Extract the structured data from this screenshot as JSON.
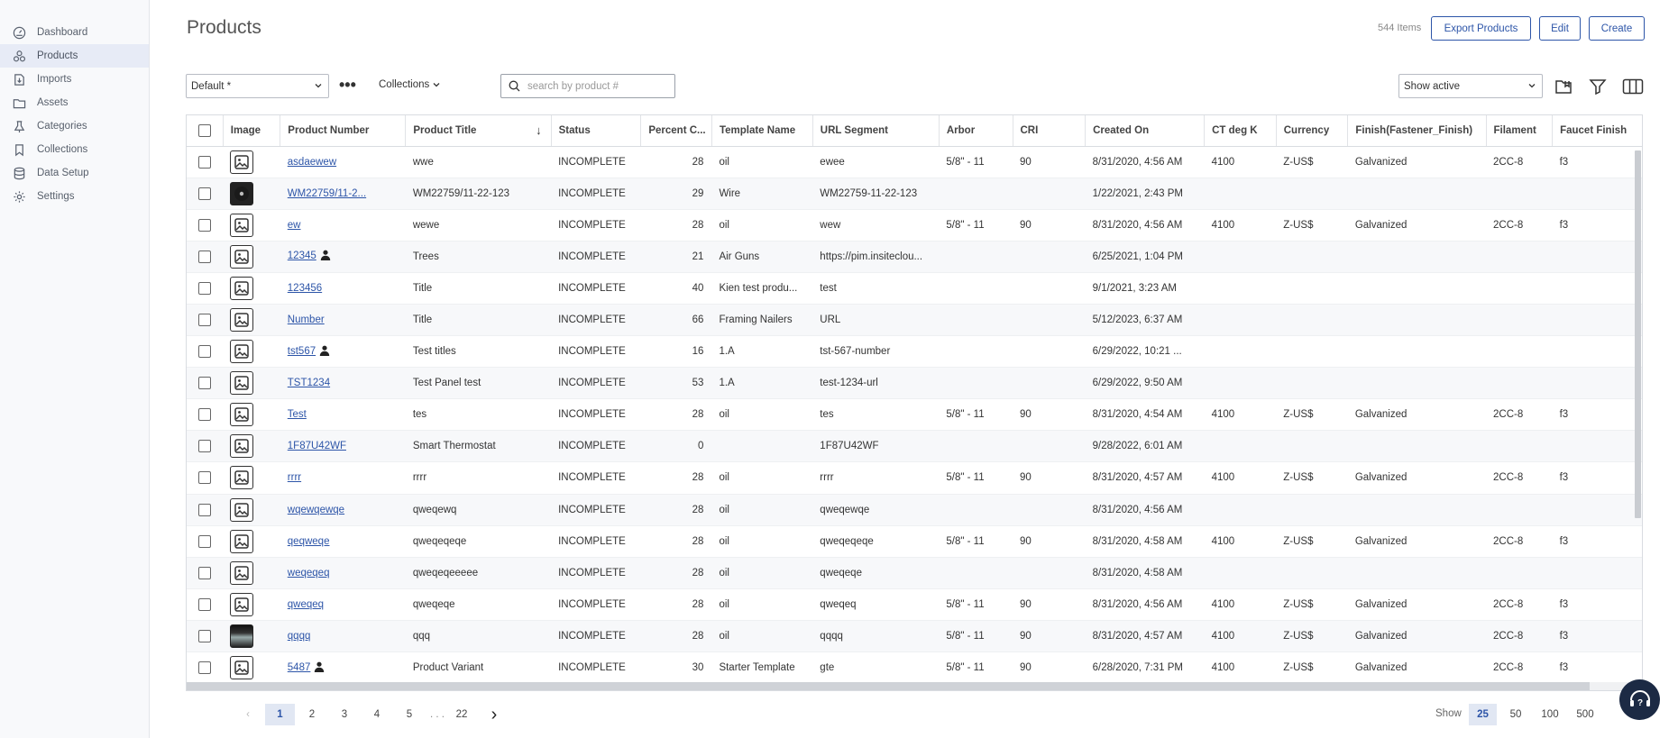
{
  "sidebar": {
    "items": [
      {
        "label": "Dashboard",
        "icon": "dashboard-icon"
      },
      {
        "label": "Products",
        "icon": "products-icon",
        "active": true
      },
      {
        "label": "Imports",
        "icon": "imports-icon"
      },
      {
        "label": "Assets",
        "icon": "folder-icon"
      },
      {
        "label": "Categories",
        "icon": "categories-icon"
      },
      {
        "label": "Collections",
        "icon": "collections-icon"
      },
      {
        "label": "Data Setup",
        "icon": "database-icon"
      },
      {
        "label": "Settings",
        "icon": "gear-icon"
      }
    ]
  },
  "header": {
    "title": "Products",
    "items_count": "544 Items",
    "export_label": "Export Products",
    "edit_label": "Edit",
    "create_label": "Create"
  },
  "toolbar": {
    "view_select_value": "Default *",
    "more_label": "•••",
    "collections_label": "Collections",
    "search_placeholder": "search by product #",
    "active_select_value": "Show active"
  },
  "table": {
    "columns": [
      "Image",
      "Product Number",
      "Product Title",
      "Status",
      "Percent C...",
      "Template Name",
      "URL Segment",
      "Arbor",
      "CRI",
      "Created On",
      "CT deg K",
      "Currency",
      "Finish(Fastener_Finish)",
      "Filament",
      "Faucet Finish"
    ],
    "rows": [
      {
        "img": "image",
        "number": "asdaewew",
        "user": false,
        "title": "wwe",
        "status": "INCOMPLETE",
        "percent": "28",
        "template": "oil",
        "url": "ewee",
        "arbor": "5/8\" - 11",
        "cri": "90",
        "created": "8/31/2020, 4:56 AM",
        "ct": "4100",
        "currency": "Z-US$",
        "finish": "Galvanized",
        "filament": "2CC-8",
        "faucet": "f3"
      },
      {
        "img": "dark",
        "number": "WM22759/11-2...",
        "user": false,
        "title": "WM22759/11-22-123",
        "status": "INCOMPLETE",
        "percent": "29",
        "template": "Wire",
        "url": "WM22759-11-22-123",
        "arbor": "",
        "cri": "",
        "created": "1/22/2021, 2:43 PM",
        "ct": "",
        "currency": "",
        "finish": "",
        "filament": "",
        "faucet": ""
      },
      {
        "img": "image",
        "number": "ew",
        "user": false,
        "title": "wewe",
        "status": "INCOMPLETE",
        "percent": "28",
        "template": "oil",
        "url": "wew",
        "arbor": "5/8\" - 11",
        "cri": "90",
        "created": "8/31/2020, 4:56 AM",
        "ct": "4100",
        "currency": "Z-US$",
        "finish": "Galvanized",
        "filament": "2CC-8",
        "faucet": "f3"
      },
      {
        "img": "image",
        "number": "12345",
        "user": true,
        "title": "Trees",
        "status": "INCOMPLETE",
        "percent": "21",
        "template": "Air Guns",
        "url": "https://pim.insiteclou...",
        "arbor": "",
        "cri": "",
        "created": "6/25/2021, 1:04 PM",
        "ct": "",
        "currency": "",
        "finish": "",
        "filament": "",
        "faucet": ""
      },
      {
        "img": "image",
        "number": "123456",
        "user": false,
        "title": "Title",
        "status": "INCOMPLETE",
        "percent": "40",
        "template": "Kien test produ...",
        "url": "test",
        "arbor": "",
        "cri": "",
        "created": "9/1/2021, 3:23 AM",
        "ct": "",
        "currency": "",
        "finish": "",
        "filament": "",
        "faucet": ""
      },
      {
        "img": "image",
        "number": "Number",
        "user": false,
        "title": "Title",
        "status": "INCOMPLETE",
        "percent": "66",
        "template": "Framing Nailers",
        "url": "URL",
        "arbor": "",
        "cri": "",
        "created": "5/12/2023, 6:37 AM",
        "ct": "",
        "currency": "",
        "finish": "",
        "filament": "",
        "faucet": ""
      },
      {
        "img": "image",
        "number": "tst567",
        "user": true,
        "title": "Test titles",
        "status": "INCOMPLETE",
        "percent": "16",
        "template": "1.A",
        "url": "tst-567-number",
        "arbor": "",
        "cri": "",
        "created": "6/29/2022, 10:21 ...",
        "ct": "",
        "currency": "",
        "finish": "",
        "filament": "",
        "faucet": ""
      },
      {
        "img": "image",
        "number": "TST1234",
        "user": false,
        "title": "Test Panel test",
        "status": "INCOMPLETE",
        "percent": "53",
        "template": "1.A",
        "url": "test-1234-url",
        "arbor": "",
        "cri": "",
        "created": "6/29/2022, 9:50 AM",
        "ct": "",
        "currency": "",
        "finish": "",
        "filament": "",
        "faucet": ""
      },
      {
        "img": "image",
        "number": "Test",
        "user": false,
        "title": "tes",
        "status": "INCOMPLETE",
        "percent": "28",
        "template": "oil",
        "url": "tes",
        "arbor": "5/8\" - 11",
        "cri": "90",
        "created": "8/31/2020, 4:54 AM",
        "ct": "4100",
        "currency": "Z-US$",
        "finish": "Galvanized",
        "filament": "2CC-8",
        "faucet": "f3"
      },
      {
        "img": "image",
        "number": "1F87U42WF",
        "user": false,
        "title": "Smart Thermostat",
        "status": "INCOMPLETE",
        "percent": "0",
        "template": "",
        "url": "1F87U42WF",
        "arbor": "",
        "cri": "",
        "created": "9/28/2022, 6:01 AM",
        "ct": "",
        "currency": "",
        "finish": "",
        "filament": "",
        "faucet": ""
      },
      {
        "img": "image",
        "number": "rrrr",
        "user": false,
        "title": "rrrr",
        "status": "INCOMPLETE",
        "percent": "28",
        "template": "oil",
        "url": "rrrr",
        "arbor": "5/8\" - 11",
        "cri": "90",
        "created": "8/31/2020, 4:57 AM",
        "ct": "4100",
        "currency": "Z-US$",
        "finish": "Galvanized",
        "filament": "2CC-8",
        "faucet": "f3"
      },
      {
        "img": "image",
        "number": "wqewqewqe",
        "user": false,
        "title": "qweqewq",
        "status": "INCOMPLETE",
        "percent": "28",
        "template": "oil",
        "url": "qweqewqe",
        "arbor": "",
        "cri": "",
        "created": "8/31/2020, 4:56 AM",
        "ct": "",
        "currency": "",
        "finish": "",
        "filament": "",
        "faucet": ""
      },
      {
        "img": "image",
        "number": "qeqweqe",
        "user": false,
        "title": "qweqeqeqe",
        "status": "INCOMPLETE",
        "percent": "28",
        "template": "oil",
        "url": "qweqeqeqe",
        "arbor": "5/8\" - 11",
        "cri": "90",
        "created": "8/31/2020, 4:58 AM",
        "ct": "4100",
        "currency": "Z-US$",
        "finish": "Galvanized",
        "filament": "2CC-8",
        "faucet": "f3"
      },
      {
        "img": "image",
        "number": "weqeqeq",
        "user": false,
        "title": "qweqeqeeeee",
        "status": "INCOMPLETE",
        "percent": "28",
        "template": "oil",
        "url": "qweqeqe",
        "arbor": "",
        "cri": "",
        "created": "8/31/2020, 4:58 AM",
        "ct": "",
        "currency": "",
        "finish": "",
        "filament": "",
        "faucet": ""
      },
      {
        "img": "image",
        "number": "qweqeq",
        "user": false,
        "title": "qweqeqe",
        "status": "INCOMPLETE",
        "percent": "28",
        "template": "oil",
        "url": "qweqeq",
        "arbor": "5/8\" - 11",
        "cri": "90",
        "created": "8/31/2020, 4:56 AM",
        "ct": "4100",
        "currency": "Z-US$",
        "finish": "Galvanized",
        "filament": "2CC-8",
        "faucet": "f3"
      },
      {
        "img": "photo",
        "number": "qqqq",
        "user": false,
        "title": "qqq",
        "status": "INCOMPLETE",
        "percent": "28",
        "template": "oil",
        "url": "qqqq",
        "arbor": "5/8\" - 11",
        "cri": "90",
        "created": "8/31/2020, 4:57 AM",
        "ct": "4100",
        "currency": "Z-US$",
        "finish": "Galvanized",
        "filament": "2CC-8",
        "faucet": "f3"
      },
      {
        "img": "image",
        "number": "5487",
        "user": true,
        "title": "Product Variant",
        "status": "INCOMPLETE",
        "percent": "30",
        "template": "Starter Template",
        "url": "gte",
        "arbor": "5/8\" - 11",
        "cri": "90",
        "created": "6/28/2020, 7:31 PM",
        "ct": "4100",
        "currency": "Z-US$",
        "finish": "Galvanized",
        "filament": "2CC-8",
        "faucet": "f3"
      },
      {
        "img": "image",
        "number": "",
        "user": false,
        "title": "",
        "status": "",
        "percent": "",
        "template": "",
        "url": "",
        "arbor": "",
        "cri": "",
        "created": "",
        "ct": "",
        "currency": "",
        "finish": "",
        "filament": "",
        "faucet": ""
      }
    ]
  },
  "pagination": {
    "prev": "‹",
    "pages": [
      "1",
      "2",
      "3",
      "4",
      "5"
    ],
    "ellipsis": ". . .",
    "last": "22",
    "next": "›",
    "current": "1",
    "show_label": "Show",
    "sizes": [
      "25",
      "50",
      "100",
      "500"
    ],
    "current_size": "25"
  },
  "colors": {
    "accent": "#2d55a8",
    "help_bg": "#1c2a44",
    "sidebar_active": "#e7ebf6"
  }
}
